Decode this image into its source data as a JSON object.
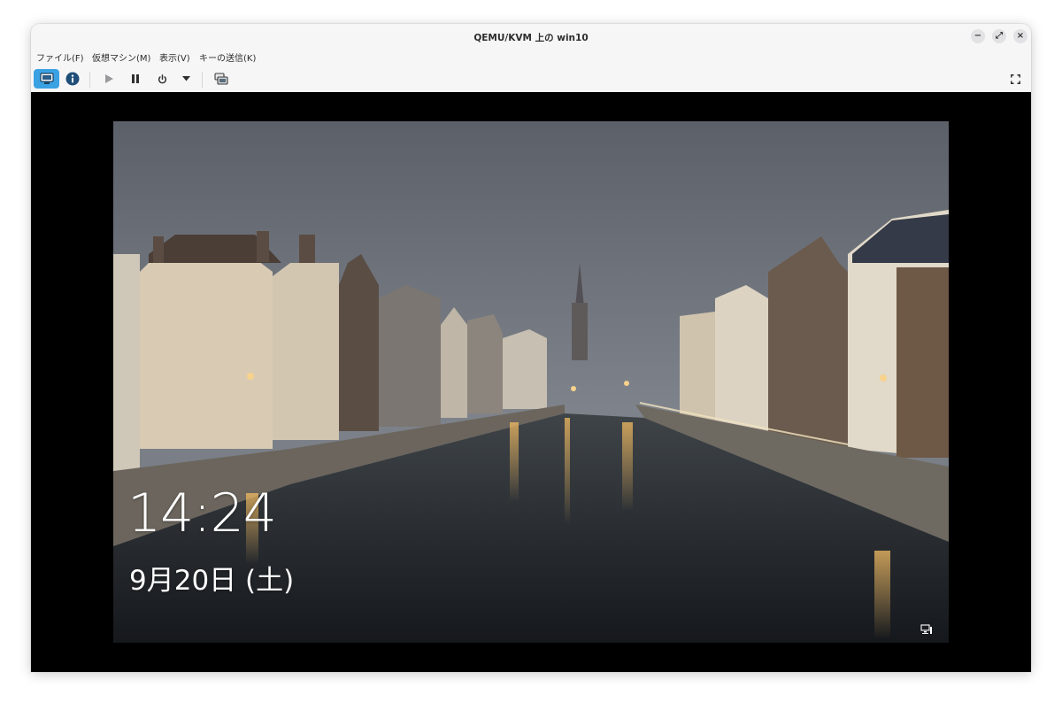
{
  "window": {
    "title": "QEMU/KVM 上の win10",
    "controls": {
      "minimize": "−",
      "maximize": "⤢",
      "close": "×"
    }
  },
  "menu": {
    "items": [
      {
        "label": "ファイル(F)"
      },
      {
        "label": "仮想マシン(M)"
      },
      {
        "label": "表示(V)"
      },
      {
        "label": "キーの送信(K)"
      }
    ]
  },
  "toolbar": {
    "accent_color": "#3aa1e3",
    "buttons": [
      {
        "icon": "monitor-icon",
        "active": true
      },
      {
        "icon": "info-icon",
        "active": false
      },
      {
        "icon": "play-icon",
        "active": false
      },
      {
        "icon": "pause-icon",
        "active": false
      },
      {
        "icon": "power-icon",
        "active": false
      },
      {
        "icon": "chevron-down-icon",
        "active": false
      },
      {
        "icon": "snapshots-icon",
        "active": false
      },
      {
        "icon": "fullscreen-icon",
        "active": false
      }
    ]
  },
  "lockscreen": {
    "time": "14:24",
    "date": "9月20日 (土)",
    "network_icon": "network-icon"
  }
}
